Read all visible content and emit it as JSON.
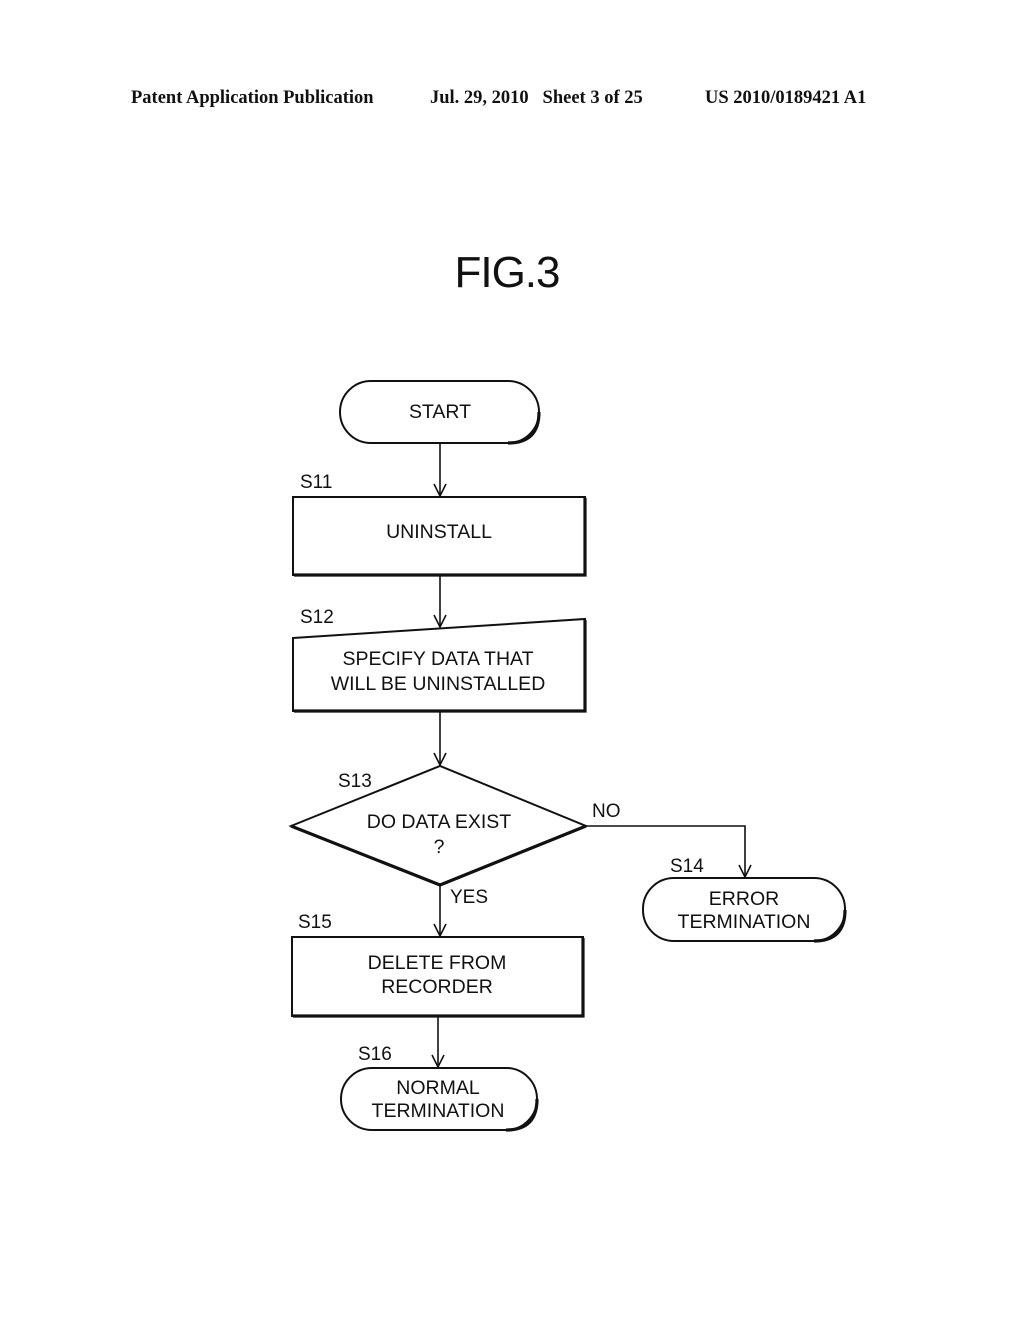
{
  "header": {
    "publication": "Patent Application Publication",
    "date_sheet": "Jul. 29, 2010   Sheet 3 of 25",
    "number": "US 2010/0189421 A1"
  },
  "figure": {
    "title": "FIG.3"
  },
  "flowchart": {
    "start": {
      "text": "START"
    },
    "s11": {
      "label": "S11",
      "lines": [
        "UNINSTALL"
      ]
    },
    "s12": {
      "label": "S12",
      "lines": [
        "SPECIFY DATA THAT",
        "WILL BE UNINSTALLED"
      ]
    },
    "s13": {
      "label": "S13",
      "lines": [
        "DO DATA EXIST",
        "?"
      ]
    },
    "s13_no": "NO",
    "s13_yes": "YES",
    "s14": {
      "label": "S14",
      "lines": [
        "ERROR",
        "TERMINATION"
      ]
    },
    "s15": {
      "label": "S15",
      "lines": [
        "DELETE FROM",
        "RECORDER"
      ]
    },
    "s16": {
      "label": "S16",
      "lines": [
        "NORMAL",
        "TERMINATION"
      ]
    }
  }
}
